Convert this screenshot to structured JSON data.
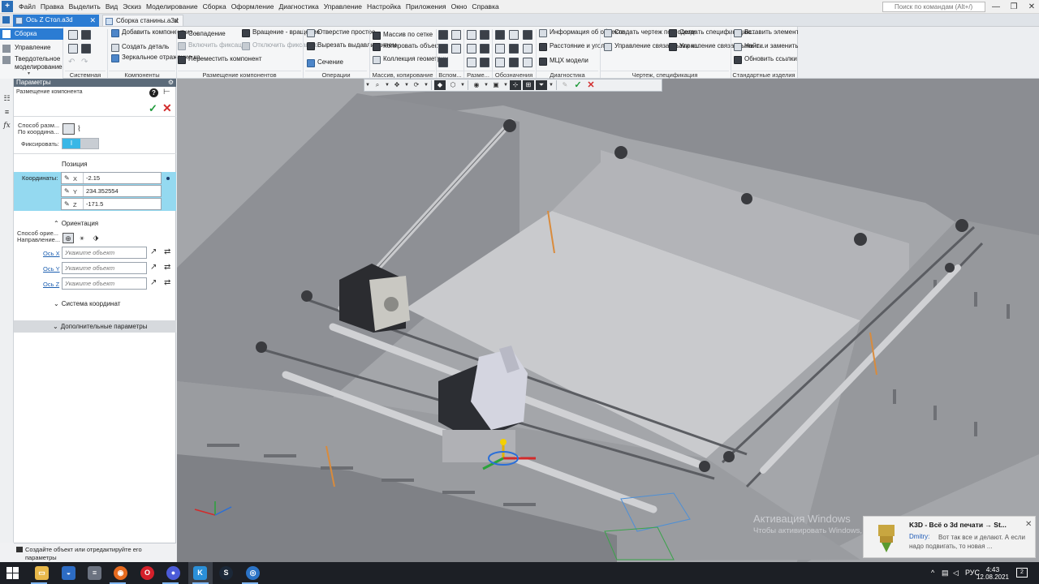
{
  "app": {
    "menu": [
      "Файл",
      "Правка",
      "Выделить",
      "Вид",
      "Эскиз",
      "Моделирование",
      "Сборка",
      "Оформление",
      "Диагностика",
      "Управление",
      "Настройка",
      "Приложения",
      "Окно",
      "Справка"
    ],
    "search_placeholder": "Поиск по командам (Alt+/)",
    "win_minimize": "—",
    "win_restore": "❐",
    "win_close": "✕"
  },
  "tabs": [
    {
      "label": "Ось Z Стол.a3d",
      "close": "✕",
      "active": true
    },
    {
      "label": "Сборка станины.a3d",
      "close": "✕",
      "active": false
    }
  ],
  "ribbon": {
    "modes": [
      "Сборка",
      "Управление",
      "Твердотельное моделирование"
    ],
    "components": {
      "add": "Добавить компонент из...",
      "create_part": "Создать деталь",
      "mirror": "Зеркальное отражение ко..."
    },
    "placement": {
      "coincidence": "Совпадение",
      "enable_fix": "Включить фиксацию",
      "move": "Переместить компонент",
      "rotate": "Вращение - вращение",
      "disable_fix": "Отключить фиксацию"
    },
    "operations": {
      "hole": "Отверстие простое",
      "cut": "Вырезать выдавливанием",
      "section": "Сечение"
    },
    "arrays": {
      "grid": "Массив по сетке",
      "copy": "Копировать объекты",
      "collection": "Коллекция геометрии"
    },
    "diagnostics": {
      "info": "Информация об объекте",
      "distance": "Расстояние и угол",
      "mcx": "МЦХ модели"
    },
    "drawing": {
      "create_drawing": "Создать чертеж по модели",
      "manage_linked": "Управление связанными ч...",
      "create_spec": "Создать спецификацию...",
      "manage_spec": "Управление связанными с..."
    },
    "standard": {
      "insert": "Вставить элемент",
      "find_replace": "Найти и заменить",
      "update_links": "Обновить ссылки на мод..."
    },
    "group_labels": {
      "system": "Системная",
      "components": "Компоненты",
      "placement": "Размещение компонентов",
      "operations": "Операции",
      "arrays": "Массив, копирование",
      "aux": "Вспом...",
      "dims": "Разме...",
      "notation": "Обозначения",
      "diagnostics": "Диагностика",
      "drawing": "Чертеж, спецификация",
      "standard": "Стандартные изделия"
    }
  },
  "panel": {
    "header": "Параметры",
    "subtitle": "Размещение компонента",
    "method_label": "Способ разм... По координа...",
    "fix_label": "Фиксировать:",
    "fix_value": "I",
    "position_title": "Позиция",
    "coords_label": "Координаты:",
    "coords": [
      {
        "axis": "X",
        "value": "-2.15"
      },
      {
        "axis": "Y",
        "value": "234.352554"
      },
      {
        "axis": "Z",
        "value": "-171.5"
      }
    ],
    "orientation_title": "Ориентация",
    "orientation_method": "Способ орие... Направление...",
    "axes": [
      {
        "label": "Ось X",
        "placeholder": "Укажите объект"
      },
      {
        "label": "Ось Y",
        "placeholder": "Укажите объект"
      },
      {
        "label": "Ось Z",
        "placeholder": "Укажите объект"
      }
    ],
    "coord_system": "Система координат",
    "extra_params": "Дополнительные параметры",
    "status": "Создайте объект или отредактируйте его параметры"
  },
  "viewport": {
    "watermark_title": "Активация Windows",
    "watermark_text": "Чтобы активировать Windows, перейдите в раздел \"Параметры\"."
  },
  "notification": {
    "title": "K3D - Всё о 3d печати → St...",
    "sender": "Dmitry:",
    "message": "Вот так все и делают. А если надо подвигать, то новая ...",
    "close": "✕"
  },
  "taskbar": {
    "language": "РУС",
    "time": "4:43",
    "date": "12.08.2021",
    "notifications": "2"
  }
}
